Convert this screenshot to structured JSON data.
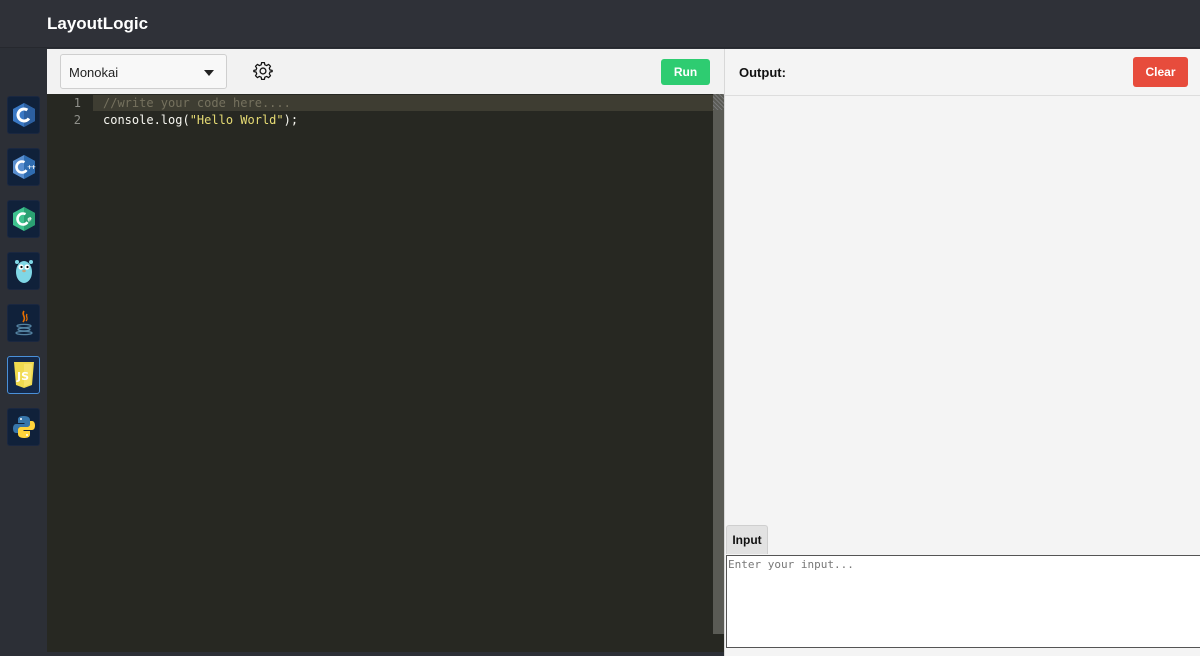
{
  "app": {
    "title": "LayoutLogic"
  },
  "sidebar": {
    "languages": [
      {
        "name": "C",
        "icon": "c-language-icon"
      },
      {
        "name": "C++",
        "icon": "cpp-language-icon"
      },
      {
        "name": "C#",
        "icon": "csharp-language-icon"
      },
      {
        "name": "Go",
        "icon": "go-gopher-icon"
      },
      {
        "name": "Java",
        "icon": "java-coffee-icon"
      },
      {
        "name": "JavaScript",
        "icon": "js-shield-icon",
        "active": true
      },
      {
        "name": "Python",
        "icon": "python-snakes-icon"
      }
    ]
  },
  "toolbar": {
    "theme_selected": "Monokai",
    "settings_icon": "gear-icon",
    "run_label": "Run",
    "run_color": "#2ecc71"
  },
  "editor": {
    "lines": [
      {
        "number": "1",
        "text": "//write your code here...."
      },
      {
        "number": "2",
        "prefix": "console.log(",
        "string": "\"Hello World\"",
        "suffix": ");"
      }
    ],
    "background": "#272822"
  },
  "output": {
    "label": "Output:",
    "clear_label": "Clear",
    "clear_color": "#e74c3c"
  },
  "input": {
    "tab_label": "Input",
    "placeholder": "Enter your input..."
  }
}
